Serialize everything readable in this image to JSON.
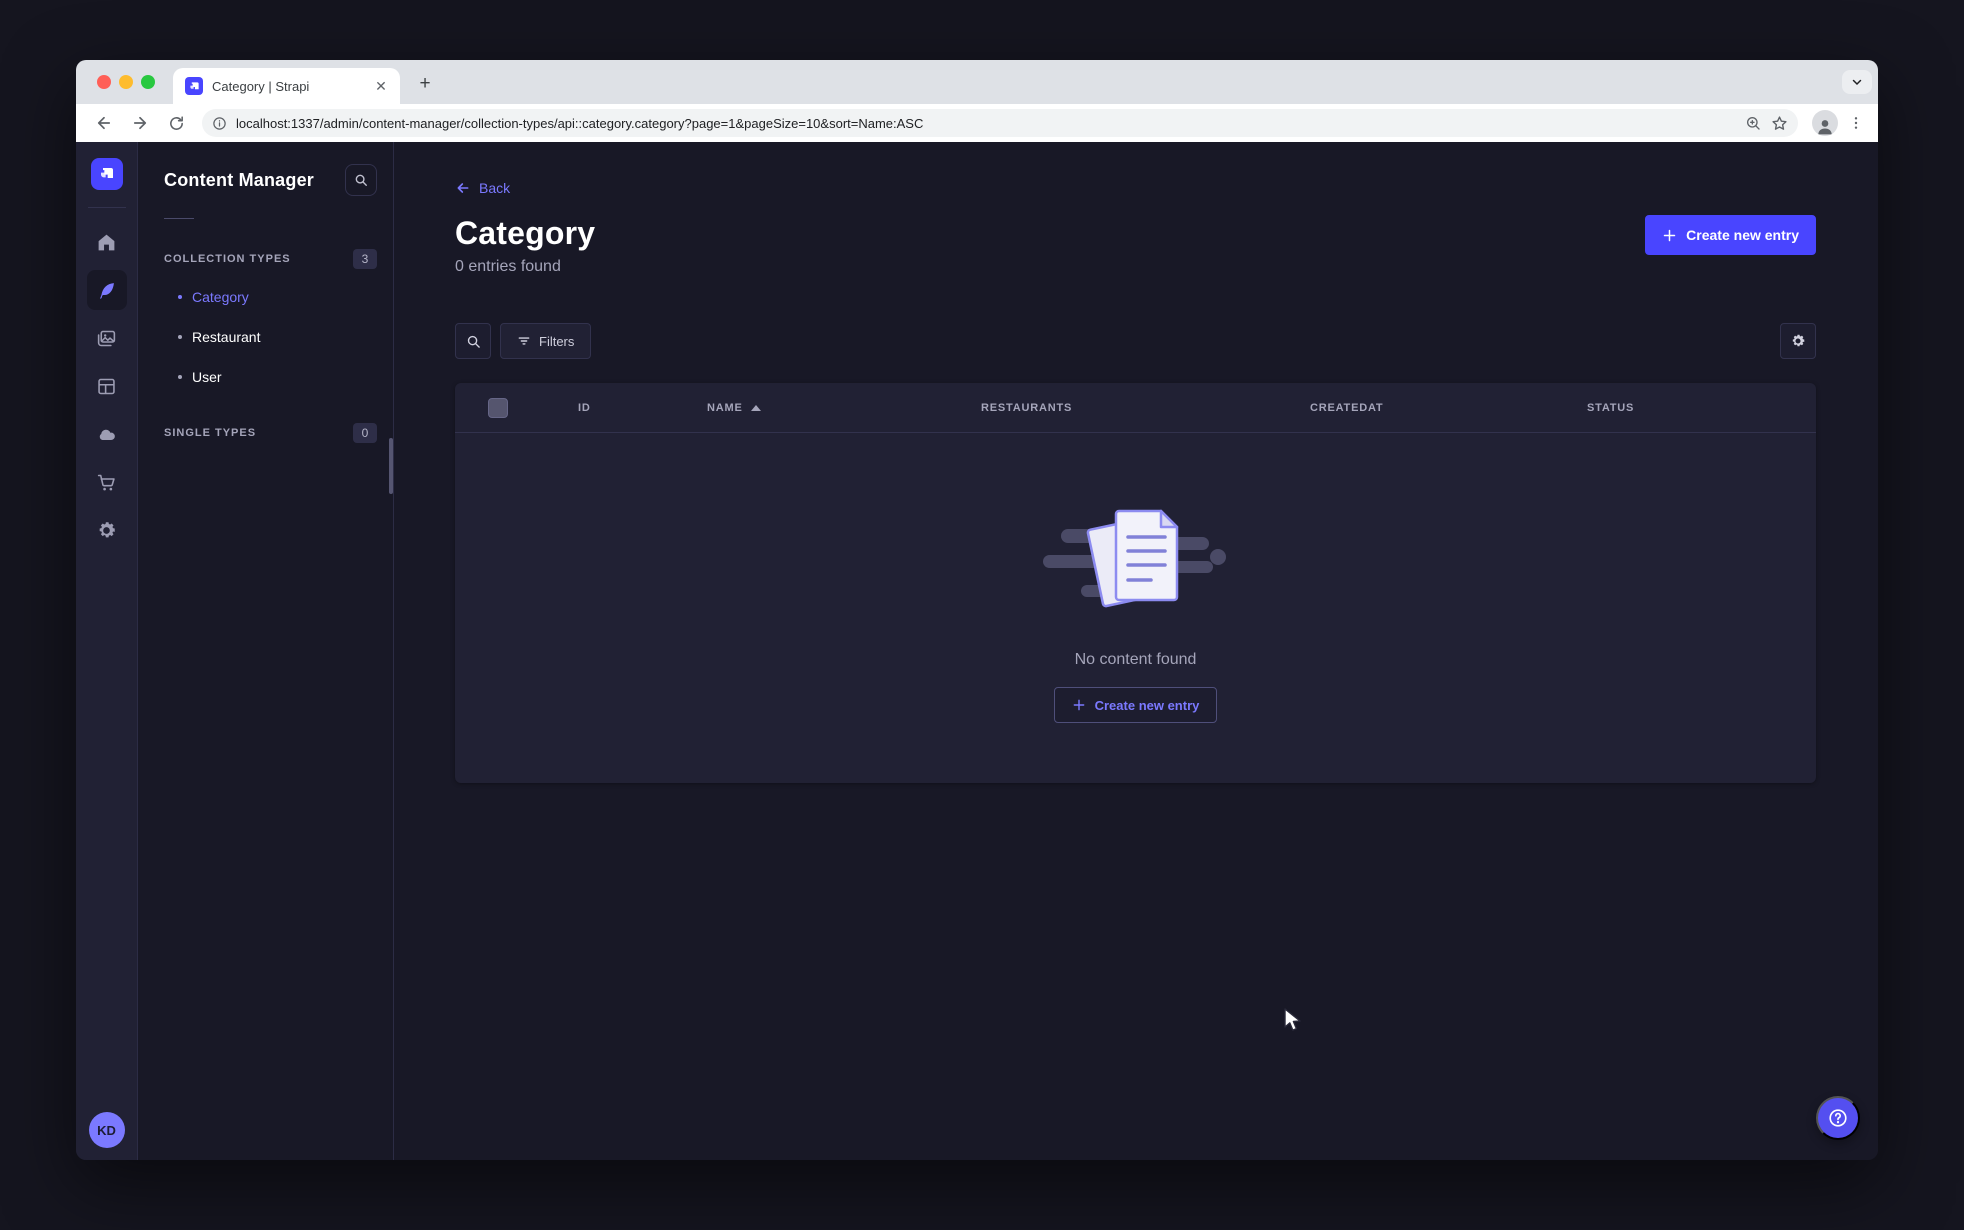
{
  "browser": {
    "tab_title": "Category | Strapi",
    "url": "localhost:1337/admin/content-manager/collection-types/api::category.category?page=1&pageSize=10&sort=Name:ASC"
  },
  "user": {
    "initials": "KD"
  },
  "subnav": {
    "title": "Content Manager",
    "sections": [
      {
        "label": "COLLECTION TYPES",
        "count": "3",
        "items": [
          {
            "label": "Category",
            "active": true
          },
          {
            "label": "Restaurant",
            "active": false
          },
          {
            "label": "User",
            "active": false
          }
        ]
      },
      {
        "label": "SINGLE TYPES",
        "count": "0",
        "items": []
      }
    ]
  },
  "main": {
    "back_label": "Back",
    "title": "Category",
    "subtitle": "0 entries found",
    "create_button_label": "Create new entry",
    "filters_label": "Filters",
    "table": {
      "columns": [
        "ID",
        "NAME",
        "RESTAURANTS",
        "CREATEDAT",
        "STATUS"
      ],
      "sorted_column": "NAME",
      "sort_direction": "asc",
      "rows": []
    },
    "empty_state": {
      "message": "No content found",
      "create_button_label": "Create new entry"
    }
  },
  "colors": {
    "primary": "#4945ff",
    "primary_light": "#7b79ff",
    "panel_bg": "#212134",
    "app_bg": "#181826"
  }
}
